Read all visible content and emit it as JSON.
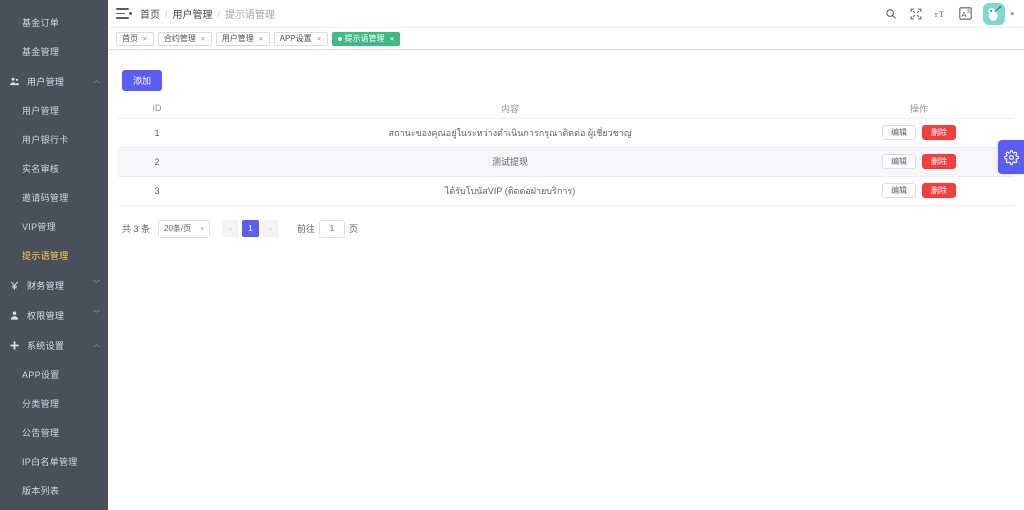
{
  "sidebar": {
    "items": [
      {
        "type": "sub",
        "label": "基金订单",
        "icon": "",
        "active": false
      },
      {
        "type": "sub",
        "label": "基金管理",
        "icon": "",
        "active": false
      },
      {
        "type": "group",
        "label": "用户管理",
        "icon": "users-icon",
        "arrow": "up"
      },
      {
        "type": "sub",
        "label": "用户管理",
        "icon": "",
        "active": false
      },
      {
        "type": "sub",
        "label": "用户银行卡",
        "icon": "",
        "active": false
      },
      {
        "type": "sub",
        "label": "实名审核",
        "icon": "",
        "active": false
      },
      {
        "type": "sub",
        "label": "邀请码管理",
        "icon": "",
        "active": false
      },
      {
        "type": "sub",
        "label": "VIP管理",
        "icon": "",
        "active": false
      },
      {
        "type": "sub",
        "label": "提示语管理",
        "icon": "",
        "active": true
      },
      {
        "type": "group",
        "label": "财务管理",
        "icon": "yen-icon",
        "arrow": "down"
      },
      {
        "type": "group",
        "label": "权限管理",
        "icon": "person-icon",
        "arrow": "down"
      },
      {
        "type": "group",
        "label": "系统设置",
        "icon": "plus-icon",
        "arrow": "up"
      },
      {
        "type": "sub",
        "label": "APP设置",
        "icon": "",
        "active": false
      },
      {
        "type": "sub",
        "label": "分类管理",
        "icon": "",
        "active": false
      },
      {
        "type": "sub",
        "label": "公告管理",
        "icon": "",
        "active": false
      },
      {
        "type": "sub",
        "label": "IP白名单管理",
        "icon": "",
        "active": false
      },
      {
        "type": "sub",
        "label": "版本列表",
        "icon": "",
        "active": false
      }
    ],
    "active_color": "#ffd04b",
    "background": "#4a4f5c"
  },
  "navbar": {
    "hamburger_icon": "hamburger-icon",
    "breadcrumb": [
      {
        "label": "首页",
        "current": false
      },
      {
        "label": "用户管理",
        "current": false
      },
      {
        "label": "提示语管理",
        "current": true
      }
    ],
    "separator": "/",
    "icons": [
      {
        "name": "search-icon",
        "glyph": "⚲"
      },
      {
        "name": "fullscreen-icon",
        "glyph": "⤢"
      },
      {
        "name": "font-size-icon",
        "glyph": "T"
      },
      {
        "name": "language-icon",
        "glyph": "A"
      }
    ],
    "avatar": {
      "name": "avatar",
      "color": "#7fd9cf"
    },
    "caret": "▾"
  },
  "tags": {
    "items": [
      {
        "label": "首页",
        "active": false
      },
      {
        "label": "合约管理",
        "active": false
      },
      {
        "label": "用户管理",
        "active": false
      },
      {
        "label": "APP设置",
        "active": false
      },
      {
        "label": "提示语管理",
        "active": true
      }
    ],
    "close_glyph": "✕",
    "active_color": "#42b983"
  },
  "toolbar": {
    "add_label": "添加",
    "add_color": "#5b5ef6"
  },
  "table": {
    "columns": [
      {
        "key": "id",
        "label": "ID"
      },
      {
        "key": "content",
        "label": "内容"
      },
      {
        "key": "op",
        "label": "操作"
      }
    ],
    "rows": [
      {
        "id": "1",
        "content": "สถานะของคุณอยู่ในระหว่างดำเนินการกรุณาติดต่อ ผู้เชี่ยวชาญ"
      },
      {
        "id": "2",
        "content": "测试提现"
      },
      {
        "id": "3",
        "content": "ได้รับโบนัสVIP (ติดต่อฝ่ายบริการ)"
      }
    ],
    "edit_label": "编辑",
    "delete_label": "删除",
    "delete_color": "#f33e3e"
  },
  "pagination": {
    "total_text": "共 3 条",
    "page_size": "20条/页",
    "prev_glyph": "‹",
    "next_glyph": "›",
    "pages": [
      "1"
    ],
    "current_page": "1",
    "jump_prefix": "前往",
    "jump_value": "1",
    "jump_suffix": "页"
  },
  "right_panel": {
    "name": "settings-gear-button",
    "color": "#5b5ef6"
  }
}
